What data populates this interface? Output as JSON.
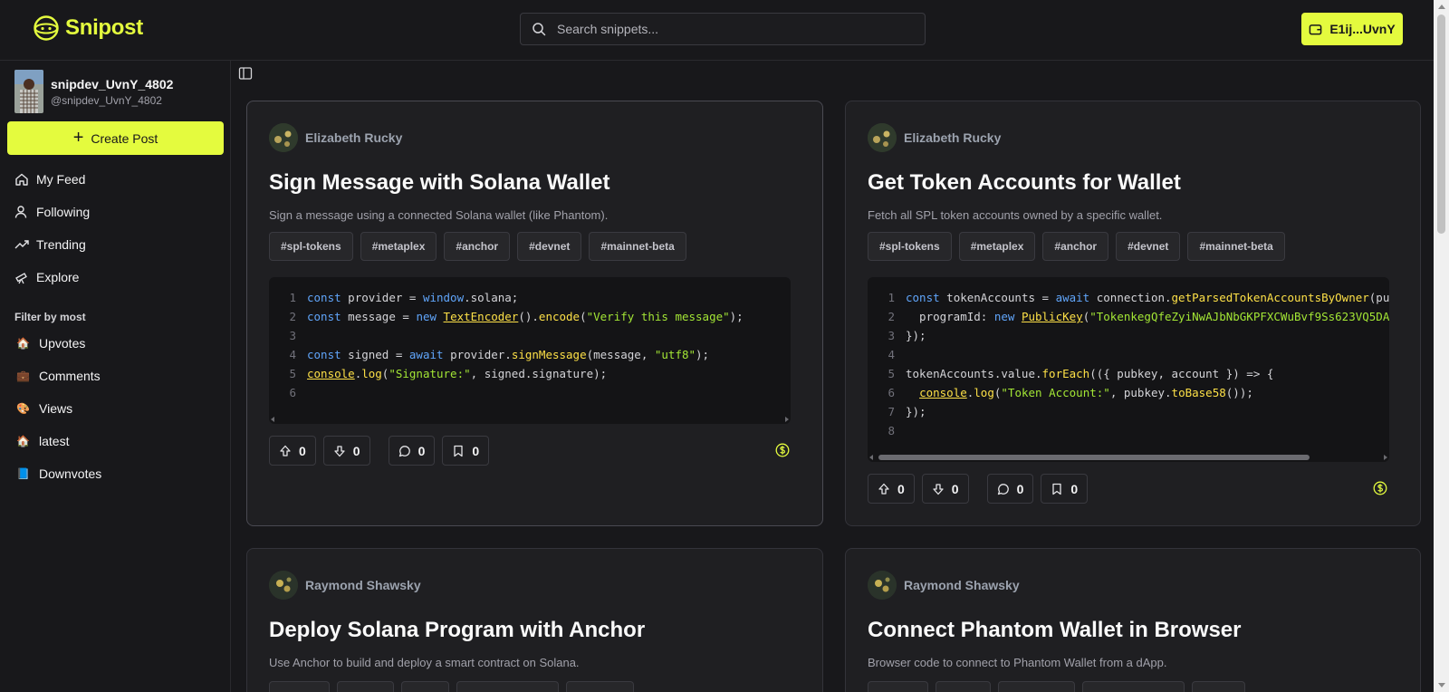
{
  "app": {
    "name": "Snipost"
  },
  "search": {
    "placeholder": "Search snippets..."
  },
  "wallet": {
    "label": "E1ij...UvnY"
  },
  "profile": {
    "name": "snipdev_UvnY_4802",
    "handle": "@snipdev_UvnY_4802"
  },
  "create_post": {
    "label": "Create Post"
  },
  "nav": [
    {
      "label": "My Feed",
      "icon": "home-icon"
    },
    {
      "label": "Following",
      "icon": "user-icon"
    },
    {
      "label": "Trending",
      "icon": "trending-up-icon"
    },
    {
      "label": "Explore",
      "icon": "telescope-icon"
    }
  ],
  "filter": {
    "heading": "Filter by most",
    "items": [
      {
        "label": "Upvotes",
        "emoji": "🏠"
      },
      {
        "label": "Comments",
        "emoji": "💼"
      },
      {
        "label": "Views",
        "emoji": "🎨"
      },
      {
        "label": "latest",
        "emoji": "🏠"
      },
      {
        "label": "Downvotes",
        "emoji": "📘"
      }
    ]
  },
  "posts": [
    {
      "author": "Elizabeth Rucky",
      "title": "Sign Message with Solana Wallet",
      "description": "Sign a message using a connected Solana wallet (like Phantom).",
      "tags": [
        "#spl-tokens",
        "#metaplex",
        "#anchor",
        "#devnet",
        "#mainnet-beta"
      ],
      "upvotes": "0",
      "downvotes": "0",
      "comments": "0",
      "bookmarks": "0"
    },
    {
      "author": "Elizabeth Rucky",
      "title": "Get Token Accounts for Wallet",
      "description": "Fetch all SPL token accounts owned by a specific wallet.",
      "tags": [
        "#spl-tokens",
        "#metaplex",
        "#anchor",
        "#devnet",
        "#mainnet-beta"
      ],
      "upvotes": "0",
      "downvotes": "0",
      "comments": "0",
      "bookmarks": "0"
    },
    {
      "author": "Raymond Shawsky",
      "title": "Deploy Solana Program with Anchor",
      "description": "Use Anchor to build and deploy a smart contract on Solana."
    },
    {
      "author": "Raymond Shawsky",
      "title": "Connect Phantom Wallet in Browser",
      "description": "Browser code to connect to Phantom Wallet from a dApp."
    }
  ],
  "colors": {
    "accent": "#e4fb3e",
    "background": "#18181b",
    "card": "#1f1f22"
  }
}
